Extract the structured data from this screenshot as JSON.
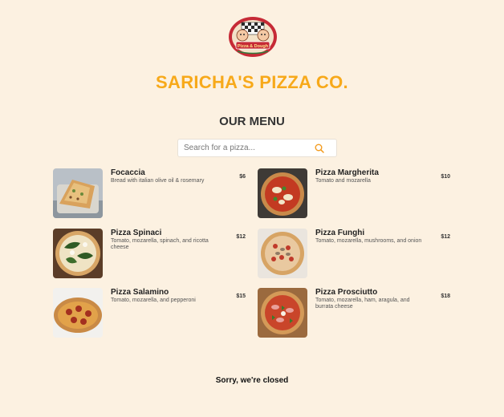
{
  "brand": {
    "logo_icon": "pizza-mascot-logo",
    "logo_text": "Pizza & Dough",
    "name": "SARICHA'S PIZZA CO.",
    "accent_color": "#f7a91a"
  },
  "menu": {
    "title": "OUR MENU",
    "search": {
      "placeholder": "Search for a pizza...",
      "value": "",
      "icon": "search-icon"
    },
    "items": [
      {
        "name": "Focaccia",
        "description": "Bread with italian olive oil & rosemary",
        "price": "$6"
      },
      {
        "name": "Pizza Margherita",
        "description": "Tomato and mozarella",
        "price": "$10"
      },
      {
        "name": "Pizza Spinaci",
        "description": "Tomato, mozarella, spinach, and ricotta cheese",
        "price": "$12"
      },
      {
        "name": "Pizza Funghi",
        "description": "Tomato, mozarella, mushrooms, and onion",
        "price": "$12"
      },
      {
        "name": "Pizza Salamino",
        "description": "Tomato, mozarella, and pepperoni",
        "price": "$15"
      },
      {
        "name": "Pizza Prosciutto",
        "description": "Tomato, mozarella, ham, aragula, and burrata cheese",
        "price": "$18"
      }
    ]
  },
  "footer": {
    "status": "Sorry, we're closed"
  }
}
